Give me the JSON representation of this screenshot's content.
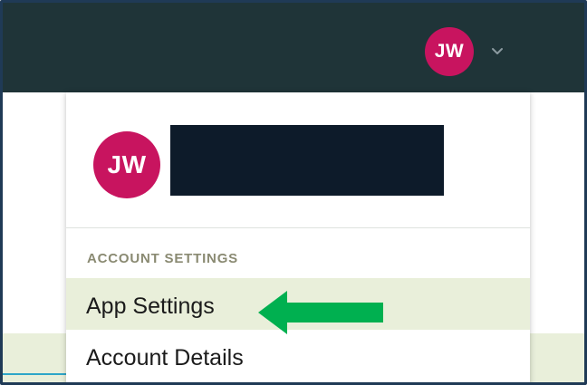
{
  "header": {
    "user_initials": "JW"
  },
  "dropdown": {
    "user_initials": "JW",
    "section_label": "ACCOUNT SETTINGS",
    "items": [
      {
        "label": "App Settings",
        "highlighted": true
      },
      {
        "label": "Account Details",
        "highlighted": false
      }
    ]
  },
  "colors": {
    "topbar": "#1f3438",
    "avatar": "#c8145f",
    "highlight": "#e9efda",
    "arrow": "#00b050"
  },
  "icons": {
    "header_toggle": "chevron-down-icon",
    "annotation": "arrow-left-icon"
  }
}
